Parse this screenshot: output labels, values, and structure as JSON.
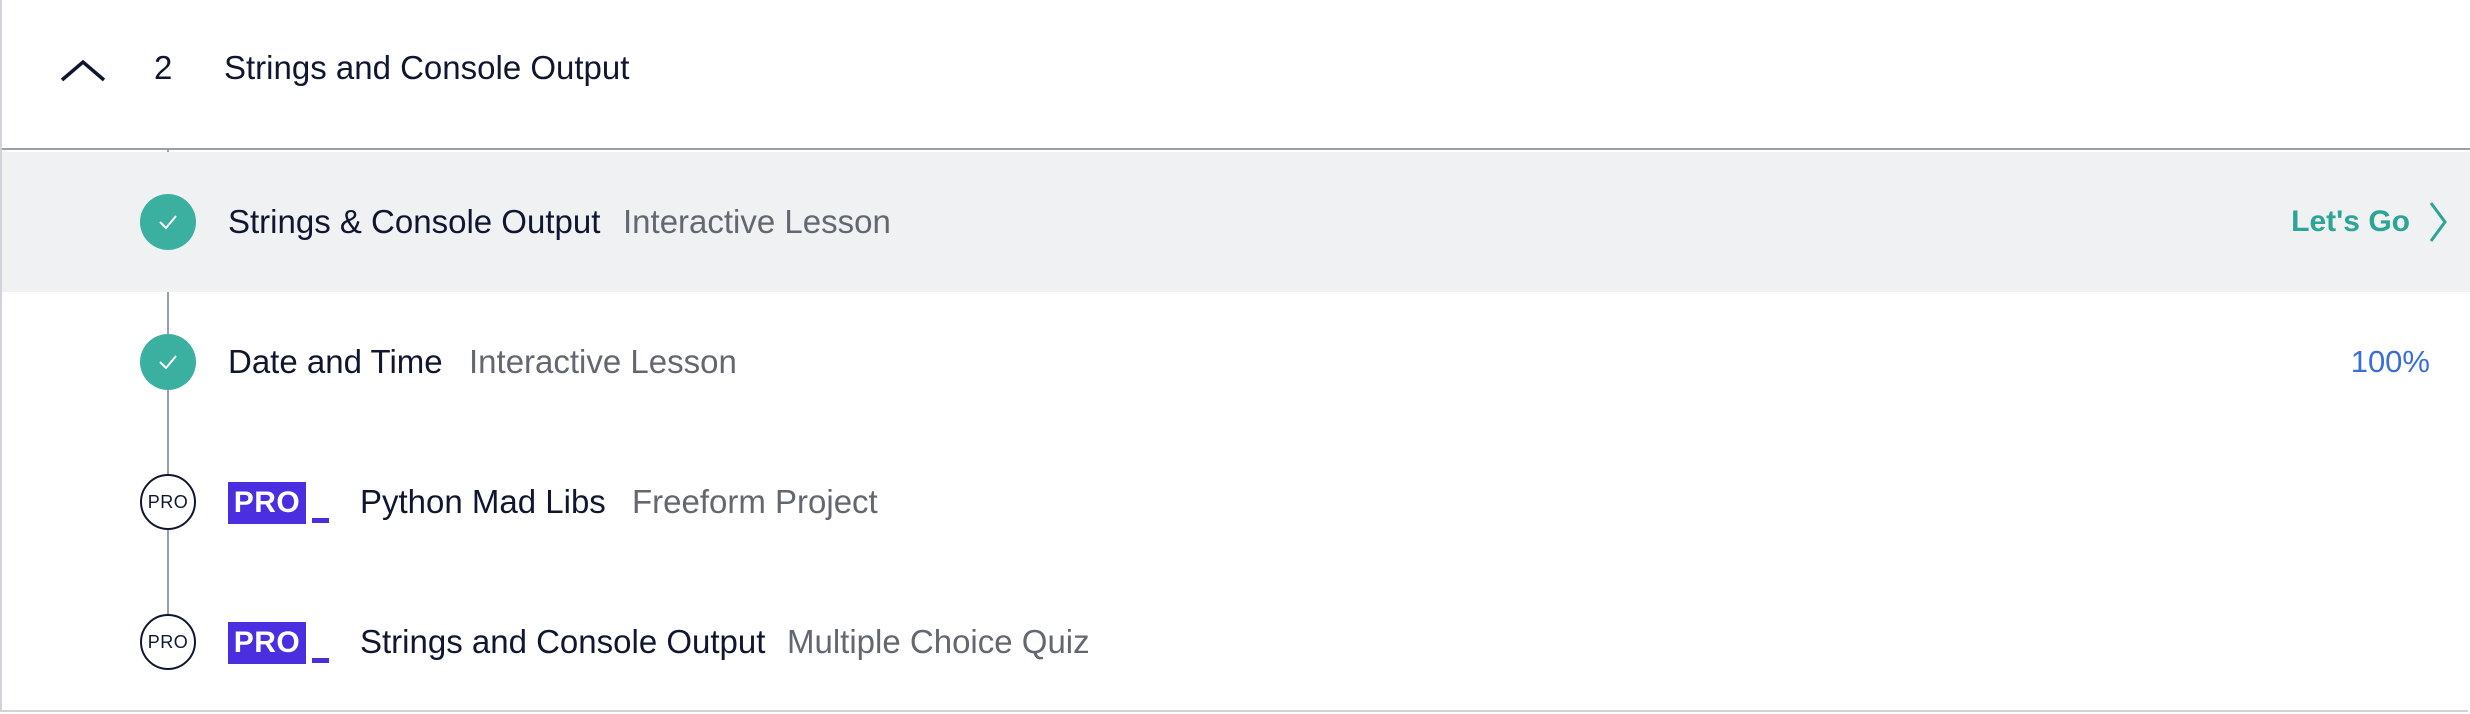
{
  "module": {
    "number": "2",
    "title": "Strings and Console Output",
    "collapse_icon": "chevron-up-icon"
  },
  "items": [
    {
      "title": "Strings & Console Output",
      "type": "Interactive Lesson",
      "status": "complete",
      "action_label": "Let's Go",
      "active": true
    },
    {
      "title": "Date and Time",
      "type": "Interactive Lesson",
      "status": "complete",
      "progress_label": "100%",
      "progress": 1.0
    },
    {
      "title": "Python Mad Libs",
      "type": "Freeform Project",
      "status": "pro",
      "status_label": "PRO",
      "badge_label": "PRO"
    },
    {
      "title": "Strings and Console Output",
      "type": "Multiple Choice Quiz",
      "status": "pro",
      "status_label": "PRO",
      "badge_label": "PRO"
    }
  ],
  "colors": {
    "complete": "#3bb0a0",
    "pro_badge": "#4a2ee0",
    "lets_go": "#2aa596",
    "percent": "#3a6fd8",
    "active_row": "#f0f1f3"
  }
}
